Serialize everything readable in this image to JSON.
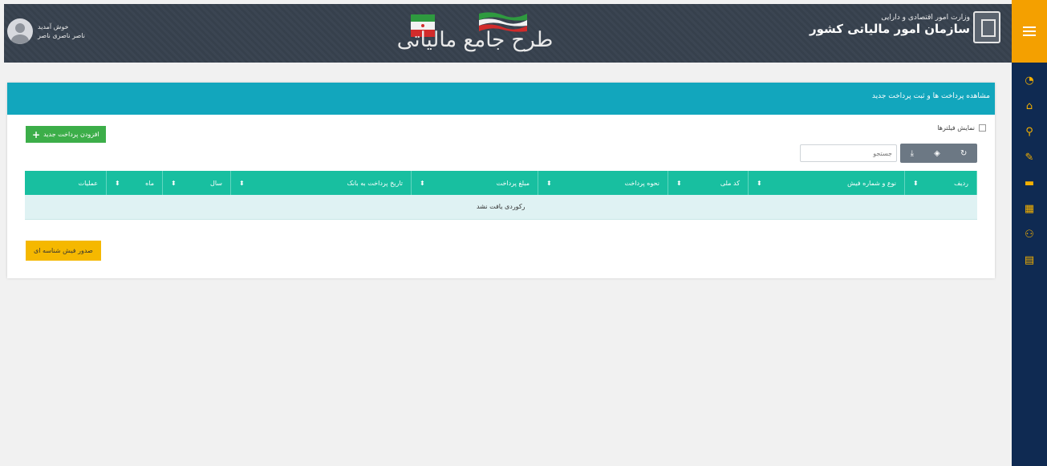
{
  "header": {
    "user_line1": "خوش آمدید",
    "user_line2": "ناصر ناصری ناصر",
    "banner_title": "طرح جامع مالیاتی",
    "ministry": "وزارت امور اقتصادی و دارایی",
    "org_name": "سازمان امور مالیاتی کشور"
  },
  "sidebar": {
    "items": [
      {
        "icon": "dashboard-icon",
        "glyph": "◔"
      },
      {
        "icon": "home-icon",
        "glyph": "⌂"
      },
      {
        "icon": "search-icon",
        "glyph": "⚲"
      },
      {
        "icon": "edit-icon",
        "glyph": "✎"
      },
      {
        "icon": "wallet-icon",
        "glyph": "▬"
      },
      {
        "icon": "calendar-icon",
        "glyph": "▦"
      },
      {
        "icon": "users-icon",
        "glyph": "⚇"
      },
      {
        "icon": "print-icon",
        "glyph": "▤"
      }
    ]
  },
  "panel": {
    "title": "مشاهده پرداخت ها و ثبت پرداخت جدید",
    "add_button": "افزودن پرداخت جدید",
    "show_filters": "نمایش فیلترها",
    "search_placeholder": "جستجو",
    "toolbar_icons": [
      "refresh-icon",
      "columns-icon",
      "export-icon"
    ],
    "columns": [
      "ردیف",
      "نوع و شماره فیش",
      "کد ملی",
      "نحوه پرداخت",
      "مبلغ پرداخت",
      "تاریخ پرداخت به بانک",
      "سال",
      "ماه",
      "عملیات"
    ],
    "empty_message": "رکوردی یافت نشد",
    "issue_button": "صدور فیش شناسه ای"
  },
  "colors": {
    "header_bg": "#39424e",
    "accent_orange": "#f4a000",
    "sidebar_bg": "#0f2a52",
    "panel_head": "#12a6bd",
    "table_head": "#18bfa0",
    "add_green": "#3cae49",
    "issue_yellow": "#f5b800"
  }
}
